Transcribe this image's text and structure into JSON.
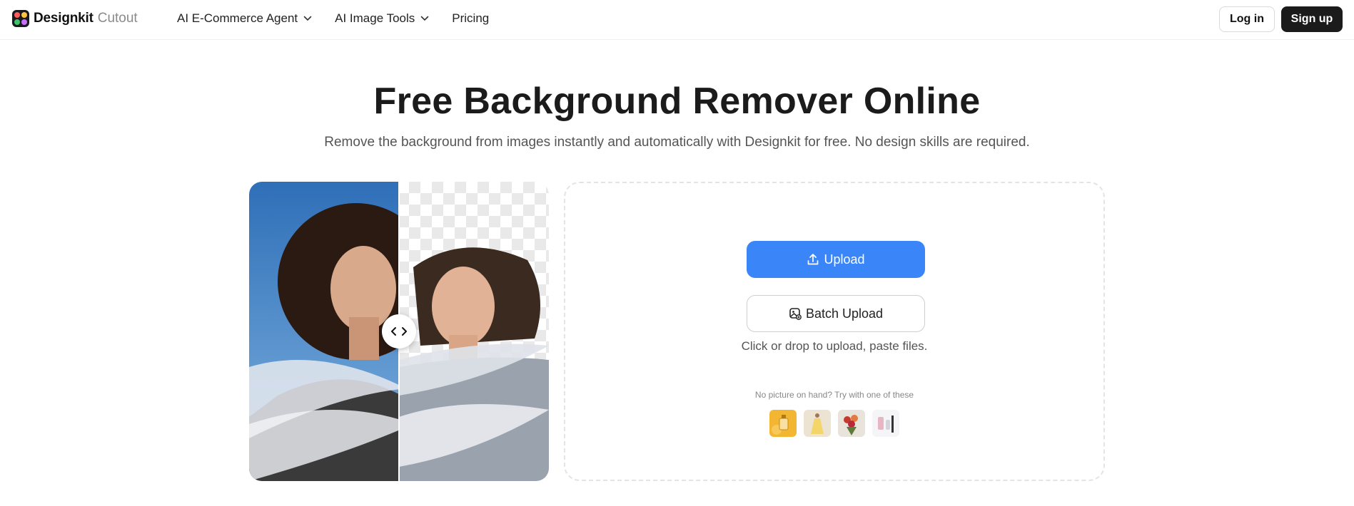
{
  "header": {
    "brand": "Designkit",
    "brand_sub": "Cutout",
    "nav": [
      {
        "label": "AI E-Commerce Agent",
        "has_dropdown": true,
        "icon": "chevron-down-icon"
      },
      {
        "label": "AI Image Tools",
        "has_dropdown": true,
        "icon": "chevron-down-icon"
      },
      {
        "label": "Pricing",
        "has_dropdown": false
      }
    ],
    "login_label": "Log in",
    "signup_label": "Sign up"
  },
  "hero": {
    "title": "Free Background Remover Online",
    "subtitle": "Remove the background from images instantly and automatically with Designkit for free. No design skills are required."
  },
  "compare": {
    "handle_icon": "left-right-arrows-icon"
  },
  "upload": {
    "upload_label": "Upload",
    "upload_icon": "upload-icon",
    "batch_label": "Batch Upload",
    "batch_icon": "batch-images-icon",
    "hint": "Click or drop to upload, paste files.",
    "try_text": "No picture on hand? Try with one of these",
    "samples": [
      "perfume-bottle-sample",
      "dress-sample",
      "flower-bouquet-sample",
      "cosmetics-sample"
    ]
  },
  "colors": {
    "primary": "#3a86f8",
    "dark": "#1b1b1b",
    "muted_text": "#555555",
    "panel_border": "#e4e4e4"
  }
}
